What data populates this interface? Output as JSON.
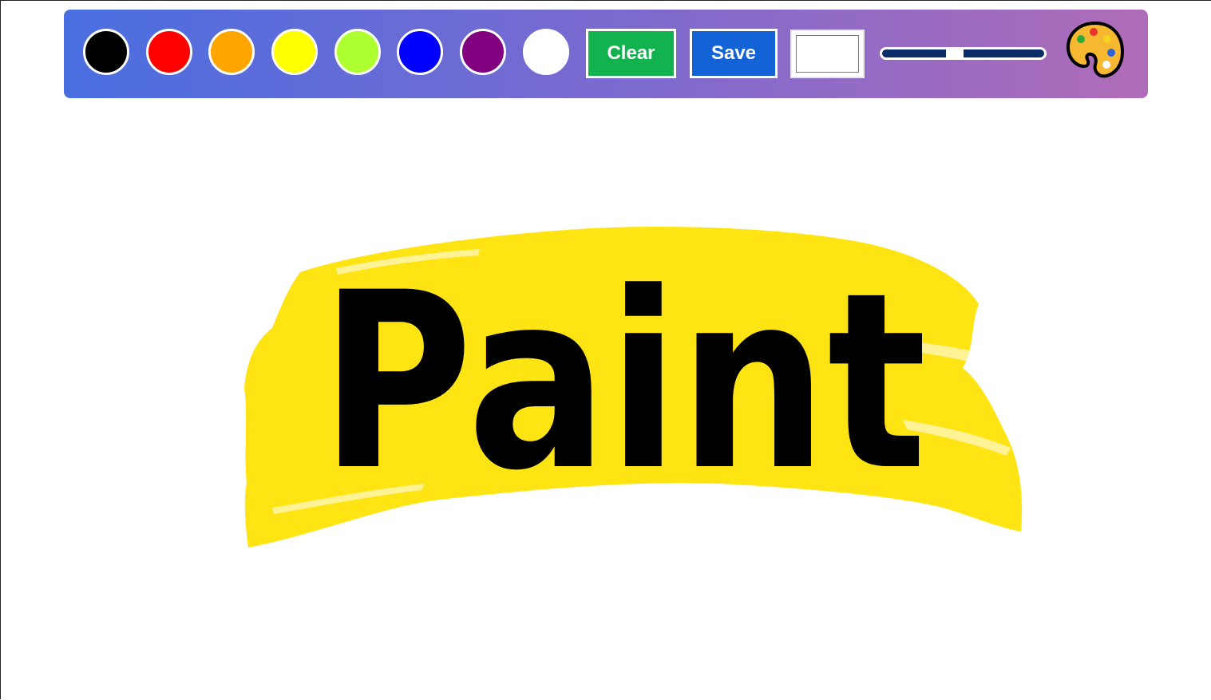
{
  "toolbar": {
    "colors": [
      {
        "name": "black",
        "hex": "#000000"
      },
      {
        "name": "red",
        "hex": "#ff0000"
      },
      {
        "name": "orange",
        "hex": "#ffa500"
      },
      {
        "name": "yellow",
        "hex": "#ffff00"
      },
      {
        "name": "green-yellow",
        "hex": "#adff2f"
      },
      {
        "name": "blue",
        "hex": "#0000ff"
      },
      {
        "name": "purple",
        "hex": "#800080"
      },
      {
        "name": "white",
        "hex": "#ffffff"
      }
    ],
    "clear_label": "Clear",
    "clear_color": "#12b24e",
    "save_label": "Save",
    "save_color": "#1463d6",
    "custom_color_value": "#ffffff",
    "brush_size": 0.45,
    "palette_icon": "palette-icon"
  },
  "canvas": {
    "logo_text": "Paint",
    "stroke_color": "#ffe414",
    "text_color": "#000000"
  }
}
